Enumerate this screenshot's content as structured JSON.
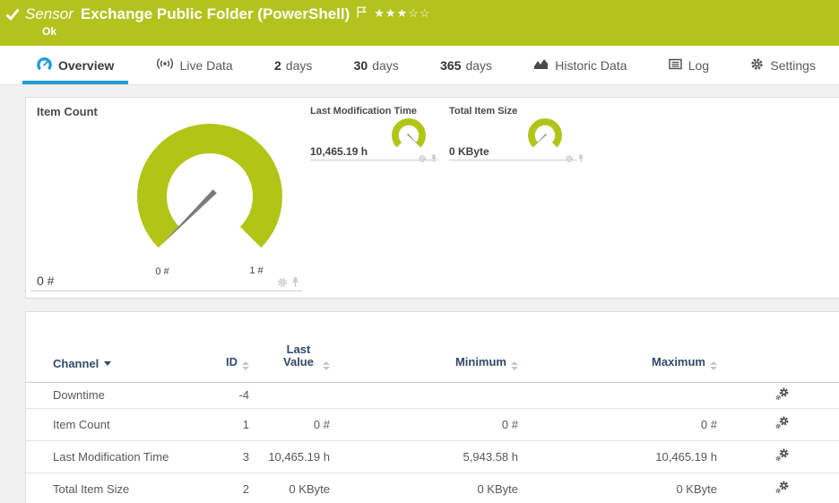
{
  "header": {
    "kind_label": "Sensor",
    "title": "Exchange Public Folder (PowerShell)",
    "status": "Ok",
    "stars_filled": "★★★",
    "stars_empty": "☆☆"
  },
  "tabs": {
    "overview": "Overview",
    "live_data": "Live Data",
    "d2_num": "2",
    "d30_num": "30",
    "d365_num": "365",
    "days_label": "days",
    "historic_data": "Historic Data",
    "log": "Log",
    "settings": "Settings"
  },
  "gauges": {
    "item_count": {
      "title": "Item Count",
      "value": "0 #",
      "min_label": "0 #",
      "max_label": "1 #"
    },
    "last_modification_time": {
      "title": "Last Modification Time",
      "value": "10,465.19 h"
    },
    "total_item_size": {
      "title": "Total Item Size",
      "value": "0 KByte"
    }
  },
  "table": {
    "headers": {
      "channel": "Channel",
      "id": "ID",
      "last_value": "Last Value",
      "minimum": "Minimum",
      "maximum": "Maximum"
    },
    "rows": [
      {
        "channel": "Downtime",
        "id": "-4",
        "last": "",
        "min": "",
        "max": ""
      },
      {
        "channel": "Item Count",
        "id": "1",
        "last": "0 #",
        "min": "0 #",
        "max": "0 #"
      },
      {
        "channel": "Last Modification Time",
        "id": "3",
        "last": "10,465.19 h",
        "min": "5,943.58 h",
        "max": "10,465.19 h"
      },
      {
        "channel": "Total Item Size",
        "id": "2",
        "last": "0 KByte",
        "min": "0 KByte",
        "max": "0 KByte"
      }
    ]
  },
  "colors": {
    "status_green": "#b3c21d",
    "gauge_green": "#b1c517",
    "accent_blue": "#1f9dd9",
    "table_header_navy": "#33496b"
  }
}
